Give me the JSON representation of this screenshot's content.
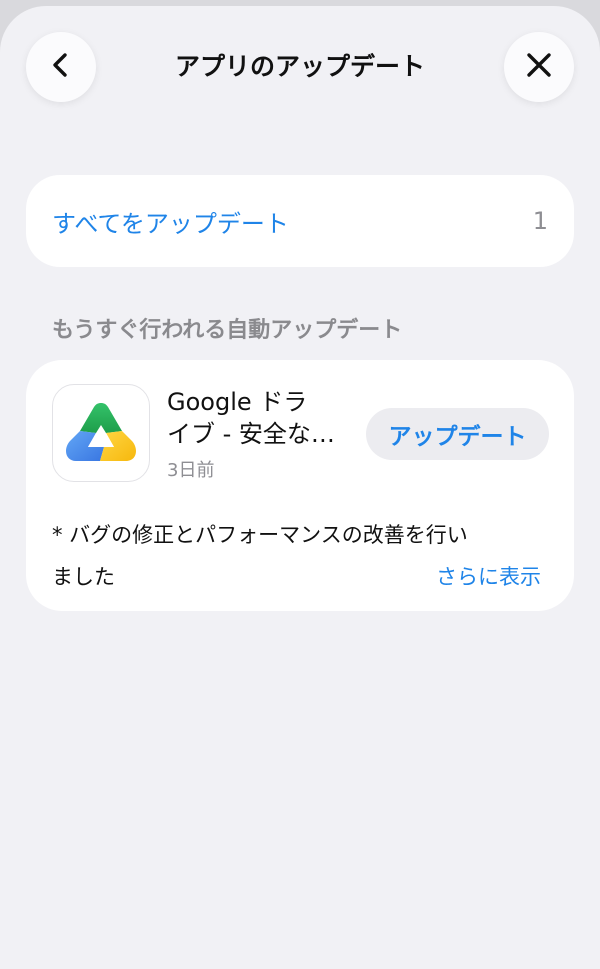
{
  "header": {
    "title": "アプリのアップデート",
    "back_icon": "chevron-left",
    "close_icon": "close-x"
  },
  "update_all": {
    "label": "すべてをアップデート",
    "count": "1"
  },
  "section": {
    "heading": "もうすぐ行われる自動アップデート"
  },
  "app": {
    "name_line1": "Google ドラ",
    "name_line2": "イブ - 安全な…",
    "date": "3日前",
    "update_label": "アップデート",
    "notes_line1": "* バグの修正とパフォーマンスの改善を行い",
    "notes_line2": "ました",
    "more_label": "さらに表示",
    "icon": "google-drive-logo"
  },
  "colors": {
    "accent": "#1f84e8",
    "background": "#f1f1f5",
    "card": "#ffffff",
    "secondary_text": "#8e8e93"
  }
}
